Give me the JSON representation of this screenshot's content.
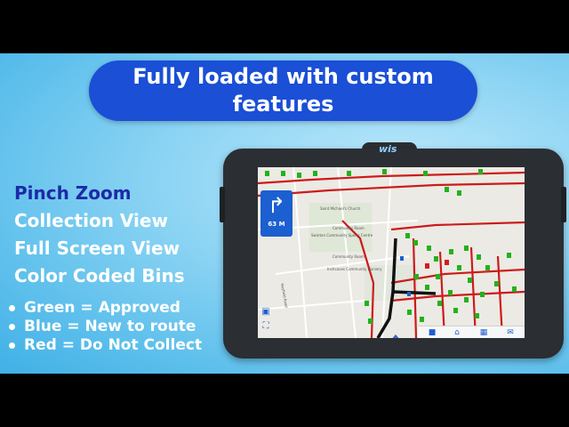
{
  "banner": {
    "line1": "Fully loaded with custom",
    "line2": "features"
  },
  "features": [
    "Pinch Zoom",
    "Collection View",
    "Full Screen View",
    "Color Coded Bins"
  ],
  "legend": [
    "Green = Approved",
    "Blue = New to route",
    "Red = Do Not Collect"
  ],
  "device": {
    "logo": "wis"
  },
  "navigation": {
    "turn_icon": "turn-right-arrow-icon",
    "distance": "63 M"
  },
  "map_labels": [
    "Saint Michael's Church",
    "Community Room",
    "Swinton Community Sports Centre",
    "Community Room",
    "Inchcaves Community Nursery",
    "Hayfield Road"
  ],
  "colors": {
    "banner": "#1a4fd6",
    "bin_approved": "#22b21a",
    "bin_new": "#1c5fd1",
    "bin_do_not_collect": "#d21f1f",
    "route": "#cc1b1b"
  }
}
